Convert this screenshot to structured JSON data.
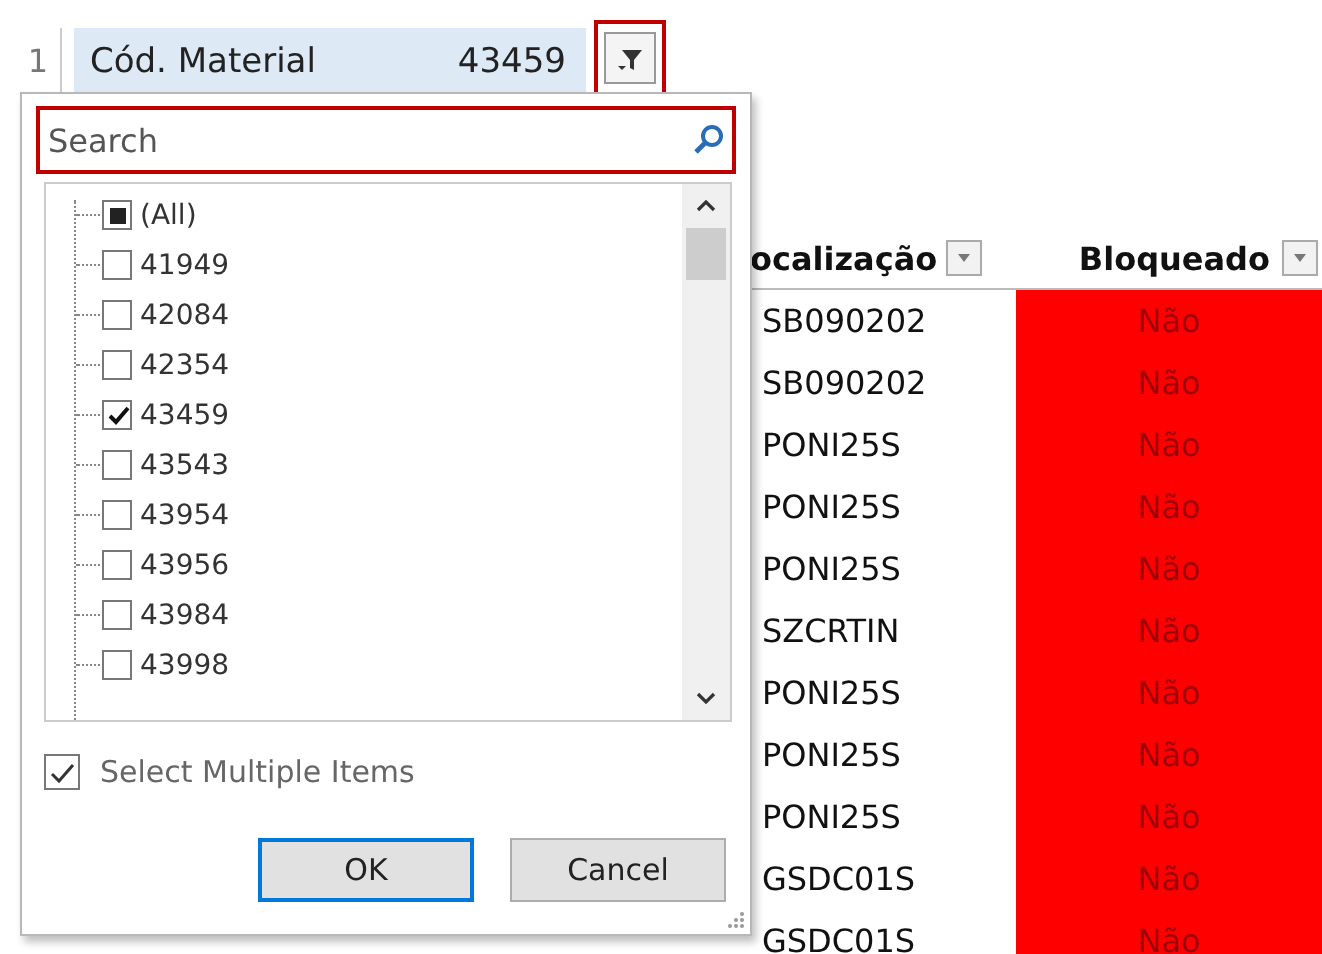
{
  "header_row": {
    "row_number": "1",
    "field_label": "Cód. Material",
    "field_value": "43459",
    "filter_active": true
  },
  "filter_panel": {
    "search": {
      "placeholder": "Search"
    },
    "all_item": {
      "label": "(All)",
      "partial": true
    },
    "items": [
      {
        "label": "41949",
        "checked": false
      },
      {
        "label": "42084",
        "checked": false
      },
      {
        "label": "42354",
        "checked": false
      },
      {
        "label": "43459",
        "checked": true
      },
      {
        "label": "43543",
        "checked": false
      },
      {
        "label": "43954",
        "checked": false
      },
      {
        "label": "43956",
        "checked": false
      },
      {
        "label": "43984",
        "checked": false
      },
      {
        "label": "43998",
        "checked": false
      }
    ],
    "select_multiple": {
      "label": "Select Multiple Items",
      "checked": true
    },
    "buttons": [
      {
        "label": "OK",
        "default": true
      },
      {
        "label": "Cancel",
        "default": false
      }
    ]
  },
  "table": {
    "columns": [
      "ocalização",
      "Bloqueado"
    ],
    "rows": [
      {
        "location": "SB090202",
        "blocked": "Não"
      },
      {
        "location": "SB090202",
        "blocked": "Não"
      },
      {
        "location": "PONI25S",
        "blocked": "Não"
      },
      {
        "location": "PONI25S",
        "blocked": "Não"
      },
      {
        "location": "PONI25S",
        "blocked": "Não"
      },
      {
        "location": "SZCRTIN",
        "blocked": "Não"
      },
      {
        "location": "PONI25S",
        "blocked": "Não"
      },
      {
        "location": "PONI25S",
        "blocked": "Não"
      },
      {
        "location": "PONI25S",
        "blocked": "Não"
      },
      {
        "location": "GSDC01S",
        "blocked": "Não"
      },
      {
        "location": "GSDC01S",
        "blocked": "Não"
      }
    ]
  }
}
